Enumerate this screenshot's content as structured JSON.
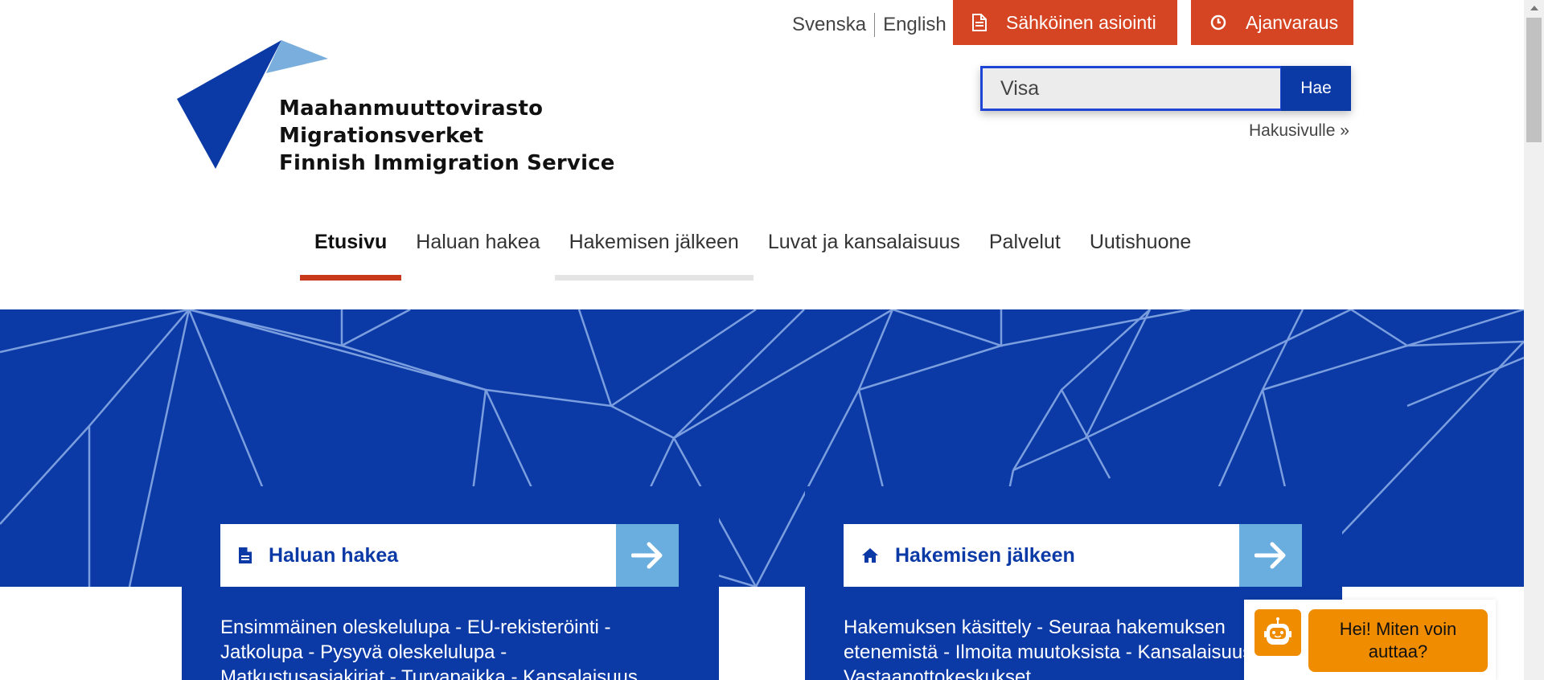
{
  "header": {
    "lang_svenska": "Svenska",
    "lang_english": "English",
    "eservice_label": "Sähköinen asiointi",
    "booking_label": "Ajanvaraus",
    "logo_line1": "Maahanmuuttovirasto",
    "logo_line2": "Migrationsverket",
    "logo_line3": "Finnish Immigration Service"
  },
  "search": {
    "value": "Visa",
    "button_label": "Hae",
    "link_label": "Hakusivulle »"
  },
  "nav": {
    "items": [
      {
        "label": "Etusivu"
      },
      {
        "label": "Haluan hakea"
      },
      {
        "label": "Hakemisen jälkeen"
      },
      {
        "label": "Luvat ja kansalaisuus"
      },
      {
        "label": "Palvelut"
      },
      {
        "label": "Uutishuone"
      }
    ]
  },
  "cards": [
    {
      "title": "Haluan hakea",
      "icon": "document-icon",
      "links_text": "Ensimmäinen oleskelulupa - EU-rekisteröinti - Jatkolupa - Pysyvä oleskelulupa - Matkustusasiakirjat - Turvapaikka - Kansalaisuus"
    },
    {
      "title": "Hakemisen jälkeen",
      "icon": "home-icon",
      "links_text": "Hakemuksen käsittely - Seuraa hakemuksen etenemistä - Ilmoita muutoksista - Kansalaisuus - Vastaanottokeskukset"
    }
  ],
  "chat": {
    "message": "Hei! Miten voin auttaa?",
    "icon": "robot-icon"
  },
  "colors": {
    "brand_blue": "#0b3aa6",
    "accent_red": "#d64523",
    "light_blue": "#6aaee0",
    "chat_orange": "#f08c00"
  }
}
